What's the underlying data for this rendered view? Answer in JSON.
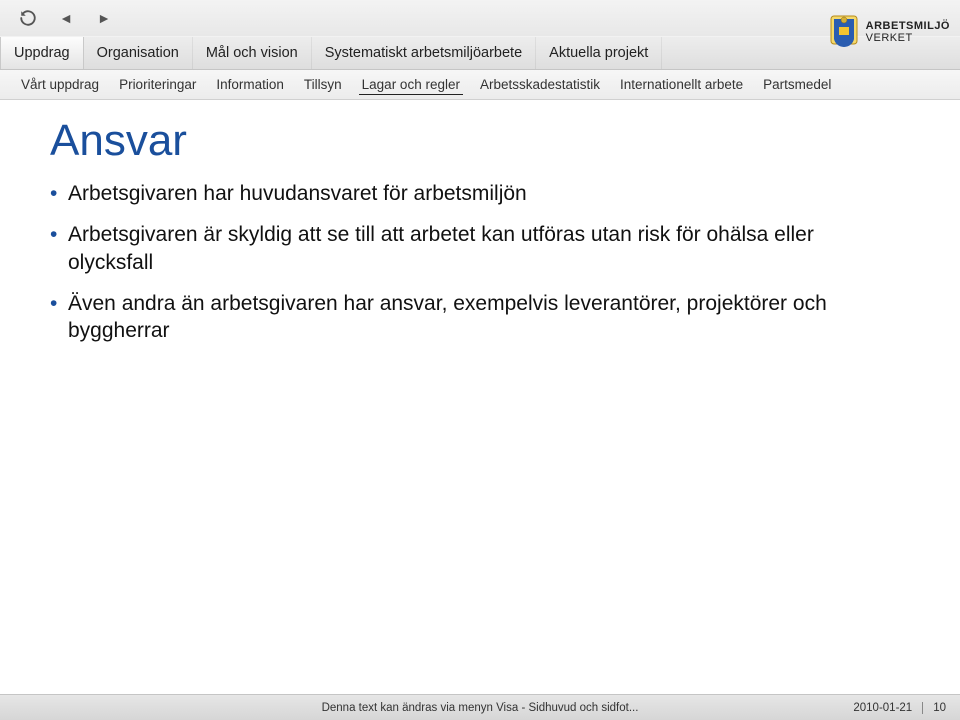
{
  "playback": {
    "refresh": "refresh",
    "prev": "◄",
    "next": "►"
  },
  "mainnav": [
    {
      "label": "Uppdrag",
      "active": true
    },
    {
      "label": "Organisation"
    },
    {
      "label": "Mål och vision"
    },
    {
      "label": "Systematiskt arbetsmiljöarbete"
    },
    {
      "label": "Aktuella projekt"
    }
  ],
  "logo": {
    "line1": "ARBETSMILJÖ",
    "line2": "VERKET"
  },
  "subnav": [
    {
      "label": "Vårt uppdrag"
    },
    {
      "label": "Prioriteringar"
    },
    {
      "label": "Information"
    },
    {
      "label": "Tillsyn"
    },
    {
      "label": "Lagar och regler",
      "active": true
    },
    {
      "label": "Arbetsskadestatistik"
    },
    {
      "label": "Internationellt arbete"
    },
    {
      "label": "Partsmedel"
    }
  ],
  "title": "Ansvar",
  "bullets": [
    "Arbetsgivaren har huvudansvaret för arbetsmiljön",
    "Arbetsgivaren är skyldig att se till att arbetet kan utföras utan risk för ohälsa eller olycksfall",
    "Även andra än arbetsgivaren har ansvar, exempelvis leverantörer, projektörer och byggherrar"
  ],
  "footer": {
    "center": "Denna text kan ändras via menyn Visa - Sidhuvud och sidfot...",
    "date": "2010-01-21",
    "page": "10"
  }
}
